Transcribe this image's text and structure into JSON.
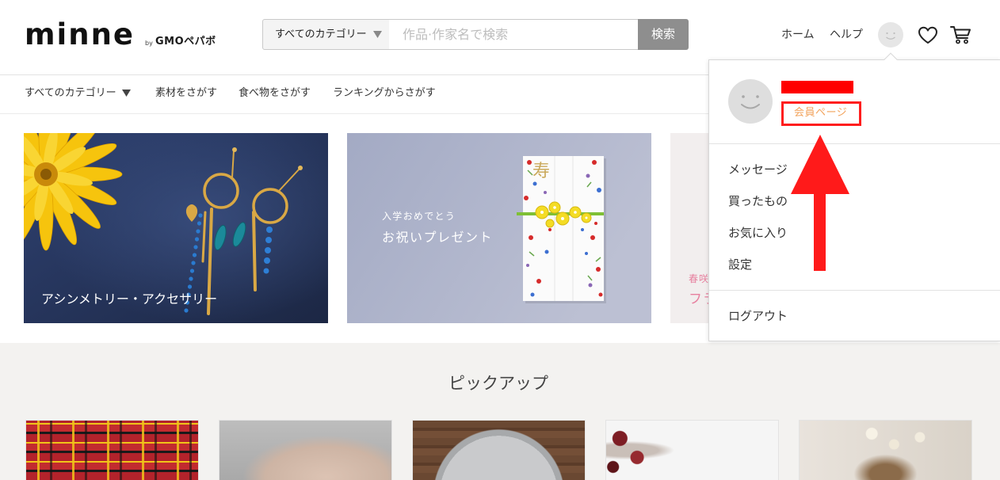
{
  "header": {
    "logo": {
      "name": "minne",
      "by": "by",
      "company": "GMOペパボ"
    },
    "search": {
      "category": "すべてのカテゴリー",
      "placeholder": "作品·作家名で検索",
      "button": "検索"
    },
    "links": {
      "home": "ホーム",
      "help": "ヘルプ"
    },
    "icons": {
      "account": "avatar-icon",
      "favorites": "heart-icon",
      "cart": "cart-icon"
    }
  },
  "category_nav": {
    "items": [
      {
        "label": "すべてのカテゴリー",
        "icon": "chevron-down-icon"
      },
      {
        "label": "素材をさがす"
      },
      {
        "label": "食べ物をさがす"
      },
      {
        "label": "ランキングからさがす"
      }
    ]
  },
  "banners": [
    {
      "caption": "アシンメトリー・アクセサリー"
    },
    {
      "subcaption": "入学おめでとう",
      "caption": "お祝いプレゼント",
      "envelope_label": "寿"
    },
    {
      "subcaption": "春咲",
      "caption": "フラ"
    }
  ],
  "pickup": {
    "title": "ピックアップ"
  },
  "user_menu": {
    "member_page": "会員ページ",
    "items": [
      {
        "label": "メッセージ"
      },
      {
        "label": "買ったもの"
      },
      {
        "label": "お気に入り"
      },
      {
        "label": "設定"
      }
    ],
    "logout": "ログアウト"
  },
  "colors": {
    "text": "#333333",
    "search_button": "#8e8e8e",
    "member_link": "#f2a35c",
    "annotation_red": "#ff1e1e",
    "pickup_background": "#f3f2f0",
    "spring_banner_text": "#e7809f"
  }
}
